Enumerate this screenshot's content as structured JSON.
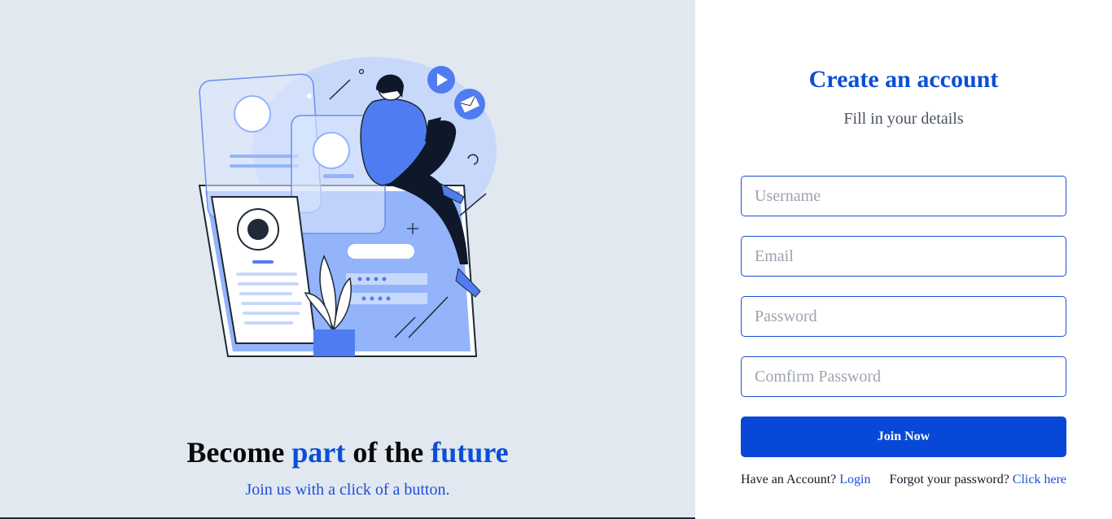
{
  "hero": {
    "heading_part1": "Become ",
    "heading_part2": "part",
    "heading_part3": " of the ",
    "heading_part4": "future",
    "subheading": "Join us with a click of a button."
  },
  "form": {
    "title": "Create an account",
    "subtitle": "Fill in your details",
    "username_placeholder": "Username",
    "email_placeholder": "Email",
    "password_placeholder": "Password",
    "confirm_placeholder": "Comfirm Password",
    "submit_label": "Join Now"
  },
  "footer": {
    "have_account_text": "Have an Account?",
    "login_link": "Login",
    "forgot_text": "Forgot your password?",
    "click_here_link": "Click here"
  },
  "colors": {
    "accent": "#0b4fd8",
    "left_bg": "#e2e8f0",
    "button_bg": "#0848d9",
    "illustration_blue": "#4f7cf0",
    "illustration_light": "#c7d8fb"
  },
  "icons": [
    "play-icon",
    "mail-icon",
    "profile-card-icon"
  ]
}
